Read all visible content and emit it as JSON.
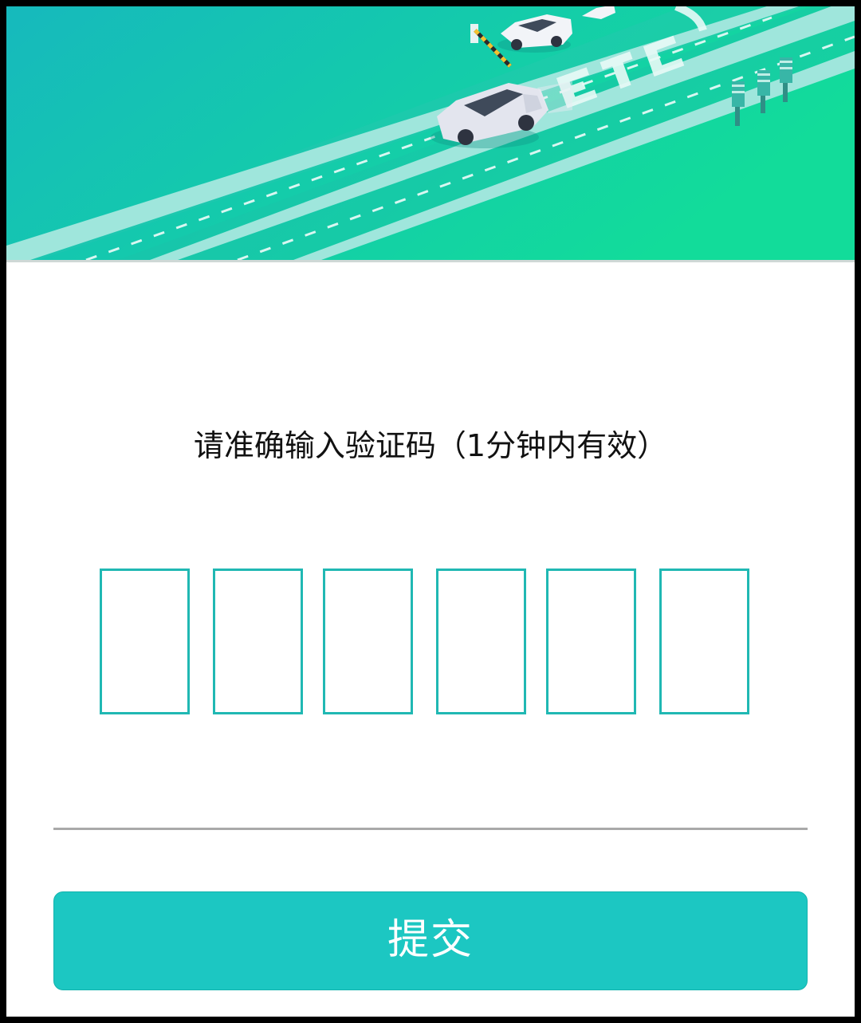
{
  "banner": {
    "colors": {
      "start": "#17c2b8",
      "end": "#11d79a"
    }
  },
  "form": {
    "instruction": "请准确输入验证码（1分钟内有效）",
    "code_digits": [
      "",
      "",
      "",
      "",
      "",
      ""
    ],
    "accent_color": "#20b8b3",
    "submit_label": "提交"
  }
}
